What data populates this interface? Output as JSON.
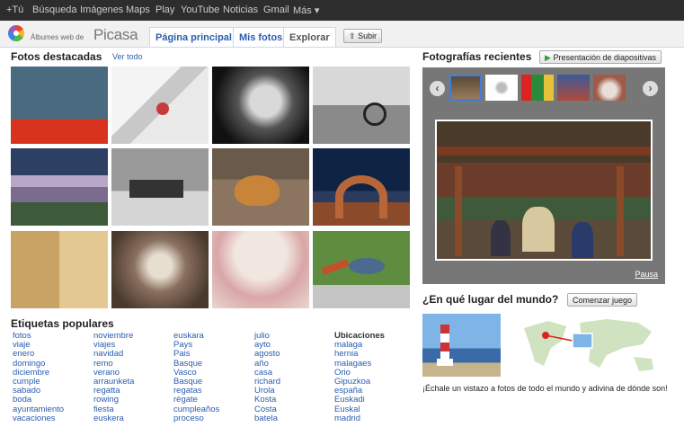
{
  "gbar": {
    "items": [
      "+Tú",
      "Búsqueda",
      "Imágenes",
      "Maps",
      "Play",
      "YouTube",
      "Noticias",
      "Gmail",
      "Más ▾"
    ]
  },
  "header": {
    "logo_small": "Álbumes web de",
    "logo_big": "Picasa",
    "tabs": [
      "Página principal",
      "Mis fotos",
      "Explorar"
    ],
    "upload_label": "Subir"
  },
  "featured": {
    "title": "Fotos destacadas",
    "see_all": "Ver todo"
  },
  "tags": {
    "title": "Etiquetas populares",
    "columns": [
      [
        "fotos",
        "viaje",
        "enero",
        "domingo",
        "diciembre",
        "cumple",
        "sabado",
        "boda",
        "ayuntamiento",
        "vacaciones"
      ],
      [
        "noviembre",
        "viajes",
        "navidad",
        "remo",
        "verano",
        "arraunketa",
        "regatta",
        "rowing",
        "fiesta",
        "euskera"
      ],
      [
        "euskara",
        "Pays",
        "Pais",
        "Basque",
        "Vasco",
        "Basque",
        "regatas",
        "régate",
        "cumpleaños",
        "proceso"
      ],
      [
        "julio",
        "ayto",
        "agosto",
        "año",
        "casa",
        "richard",
        "Urola",
        "Kosta",
        "Costa",
        "batela"
      ]
    ],
    "locations_title": "Ubicaciones",
    "locations": [
      "malaga",
      "hernia",
      "malagaes",
      "Orio",
      "Gipuzkoa",
      "españa",
      "Euskadi",
      "Euskal",
      "madrid"
    ]
  },
  "recent": {
    "title": "Fotografías recientes",
    "slideshow_label": "Presentación de diapositivas",
    "pause_label": "Pausa",
    "prev_icon": "chevron-left-icon",
    "next_icon": "chevron-right-icon"
  },
  "world": {
    "title": "¿En qué lugar del mundo?",
    "start_label": "Comenzar juego",
    "caption": "¡Échale un vistazo a fotos de todo el mundo y adivina de dónde son!"
  },
  "colors": {
    "link": "#2a5db0",
    "gbar": "#2d2d2d",
    "panel": "#777777"
  }
}
